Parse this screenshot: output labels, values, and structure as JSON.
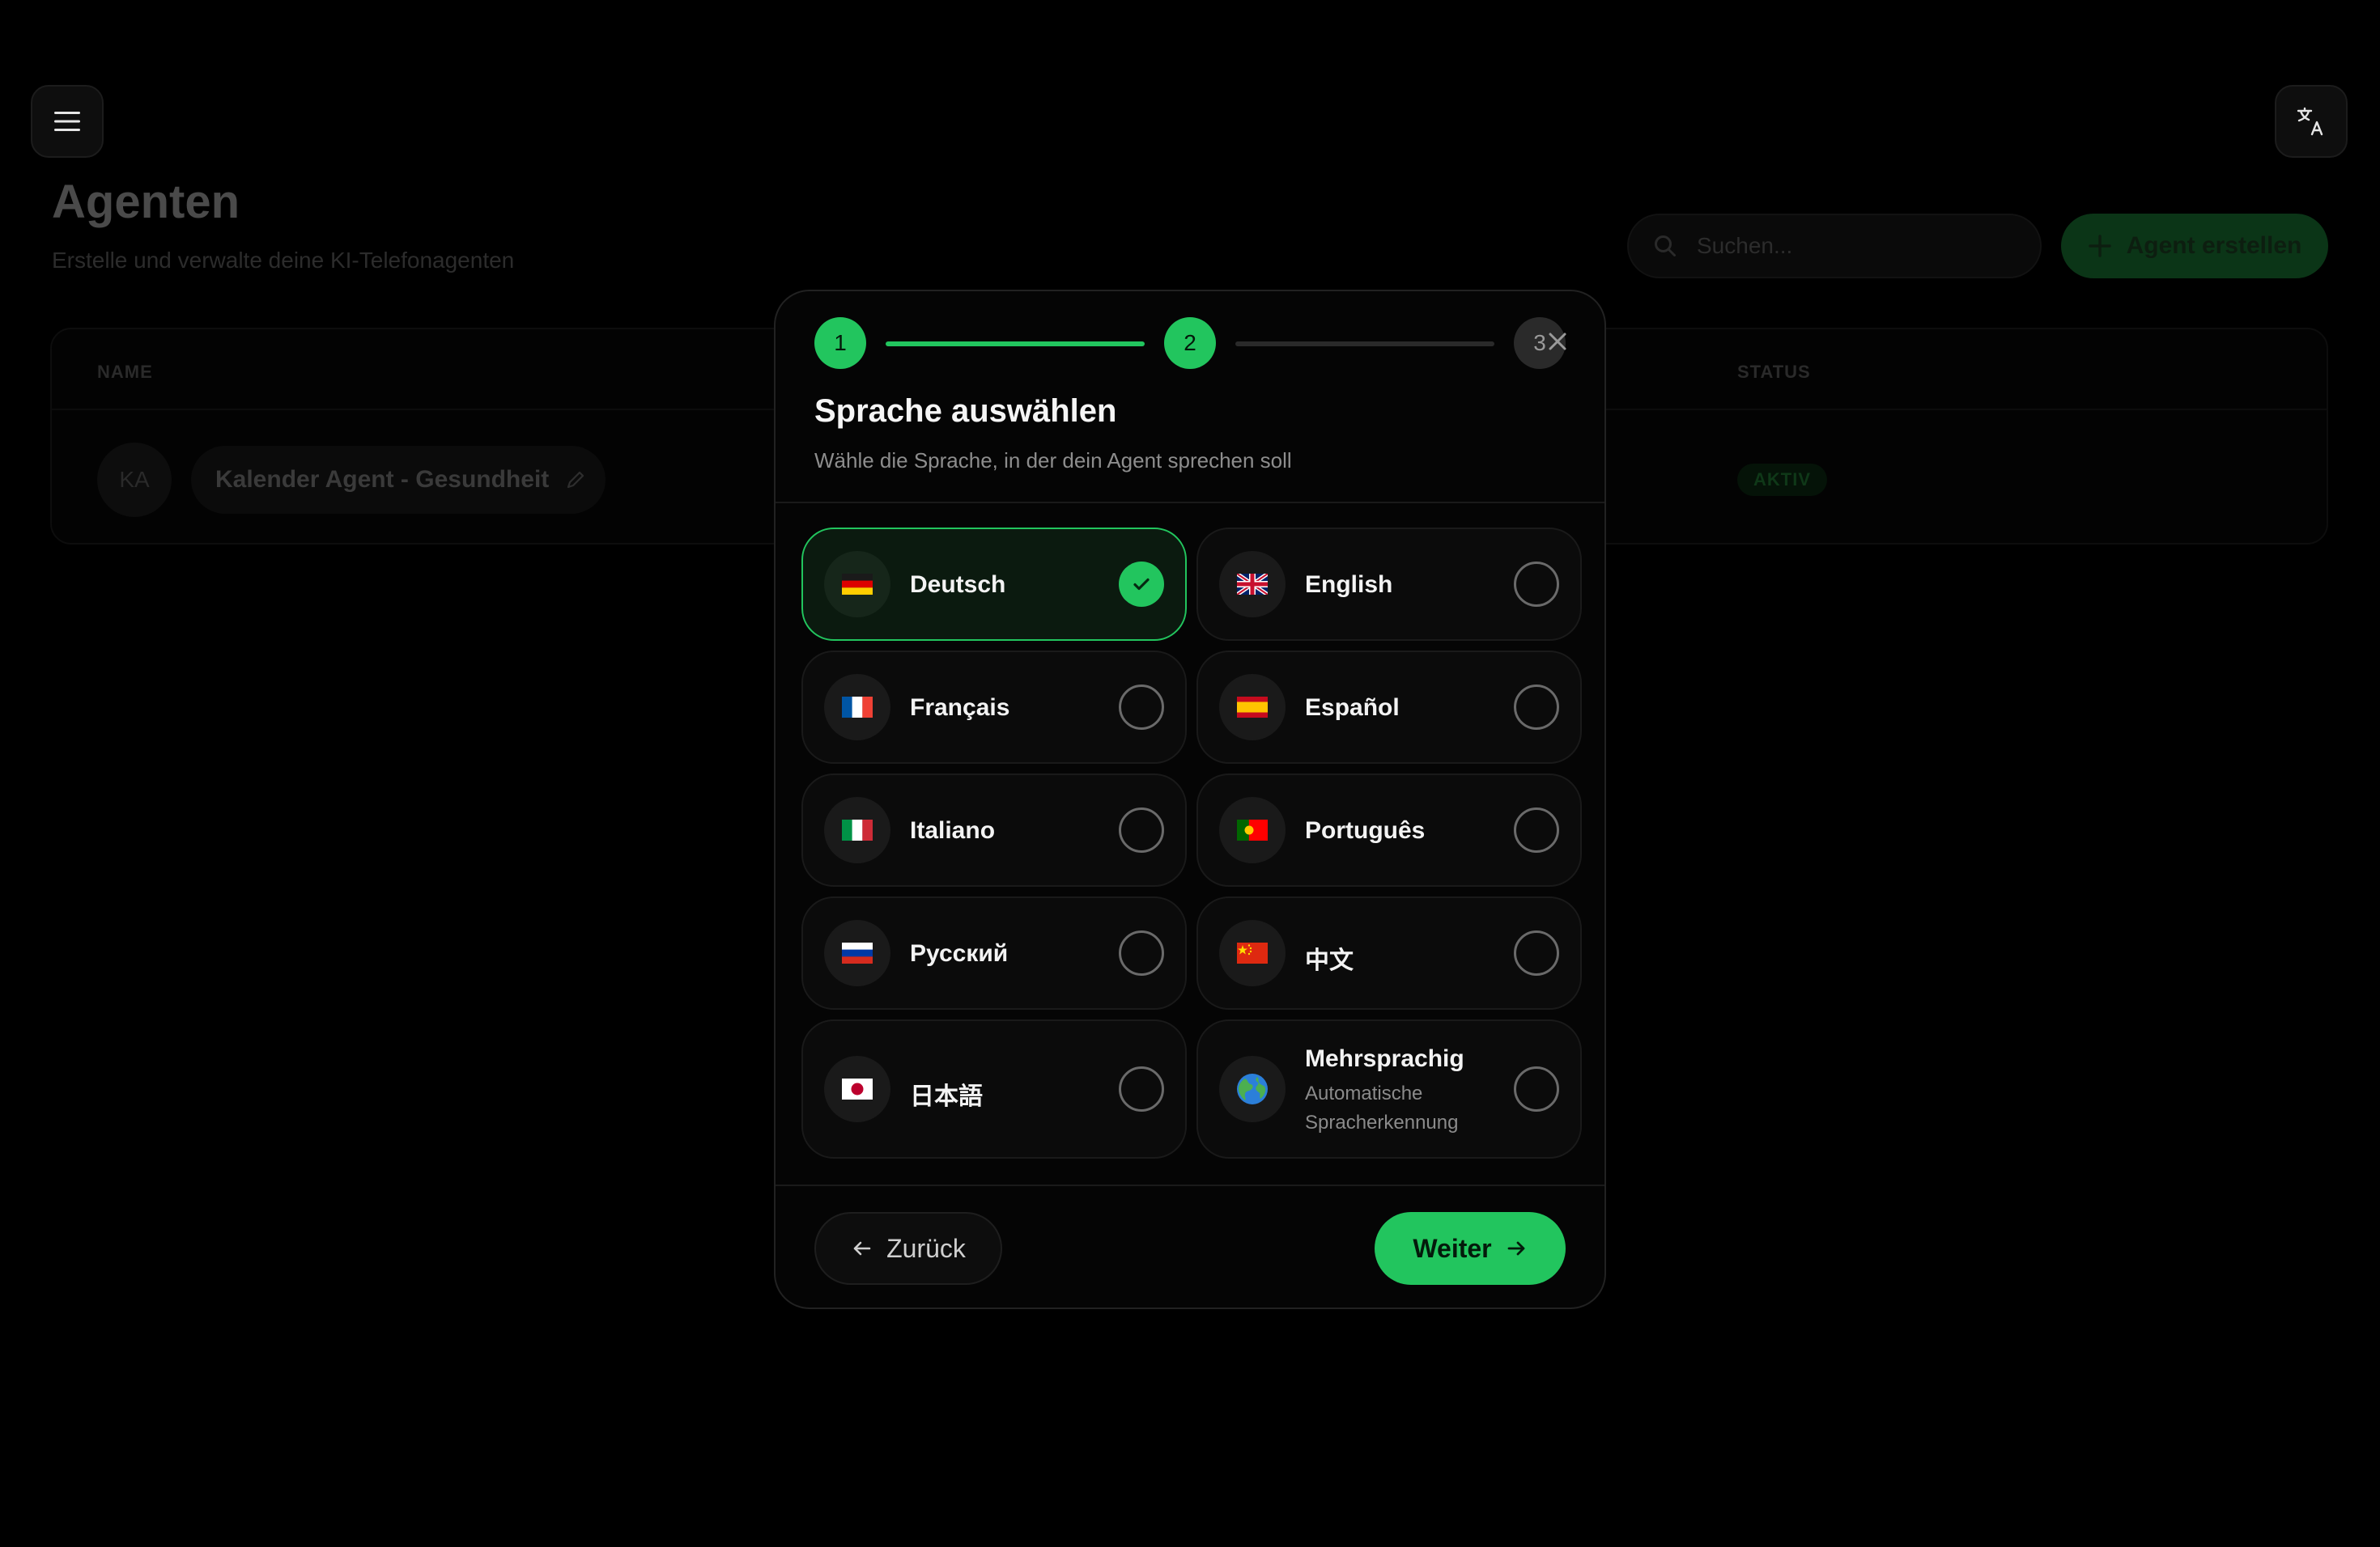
{
  "header": {
    "page_title": "Agenten",
    "page_subtitle": "Erstelle und verwalte deine KI-Telefonagenten",
    "search_placeholder": "Suchen...",
    "create_button": "Agent erstellen"
  },
  "table": {
    "columns": [
      "NAME",
      "STATUS"
    ],
    "rows": [
      {
        "initials": "KA",
        "name": "Kalender Agent - Gesundheit",
        "status": "AKTIV"
      }
    ]
  },
  "modal": {
    "steps": [
      "1",
      "2",
      "3"
    ],
    "current_step": 2,
    "title": "Sprache auswählen",
    "subtitle": "Wähle die Sprache, in der dein Agent sprechen soll",
    "options": [
      {
        "label": "Deutsch",
        "flag": "flag-de",
        "selected": true
      },
      {
        "label": "English",
        "flag": "flag-gb",
        "selected": false
      },
      {
        "label": "Français",
        "flag": "flag-fr",
        "selected": false
      },
      {
        "label": "Español",
        "flag": "flag-es",
        "selected": false
      },
      {
        "label": "Italiano",
        "flag": "flag-it",
        "selected": false
      },
      {
        "label": "Português",
        "flag": "flag-pt",
        "selected": false
      },
      {
        "label": "Русский",
        "flag": "flag-ru",
        "selected": false
      },
      {
        "label": "中文",
        "flag": "flag-cn",
        "selected": false
      },
      {
        "label": "日本語",
        "flag": "flag-jp",
        "selected": false
      },
      {
        "label": "Mehrsprachig",
        "description": "Automatische Spracherkennung",
        "flag": "globe",
        "selected": false
      }
    ],
    "back_button": "Zurück",
    "next_button": "Weiter"
  },
  "colors": {
    "accent": "#22c55e",
    "background": "#000000",
    "modal_background": "#050505"
  }
}
